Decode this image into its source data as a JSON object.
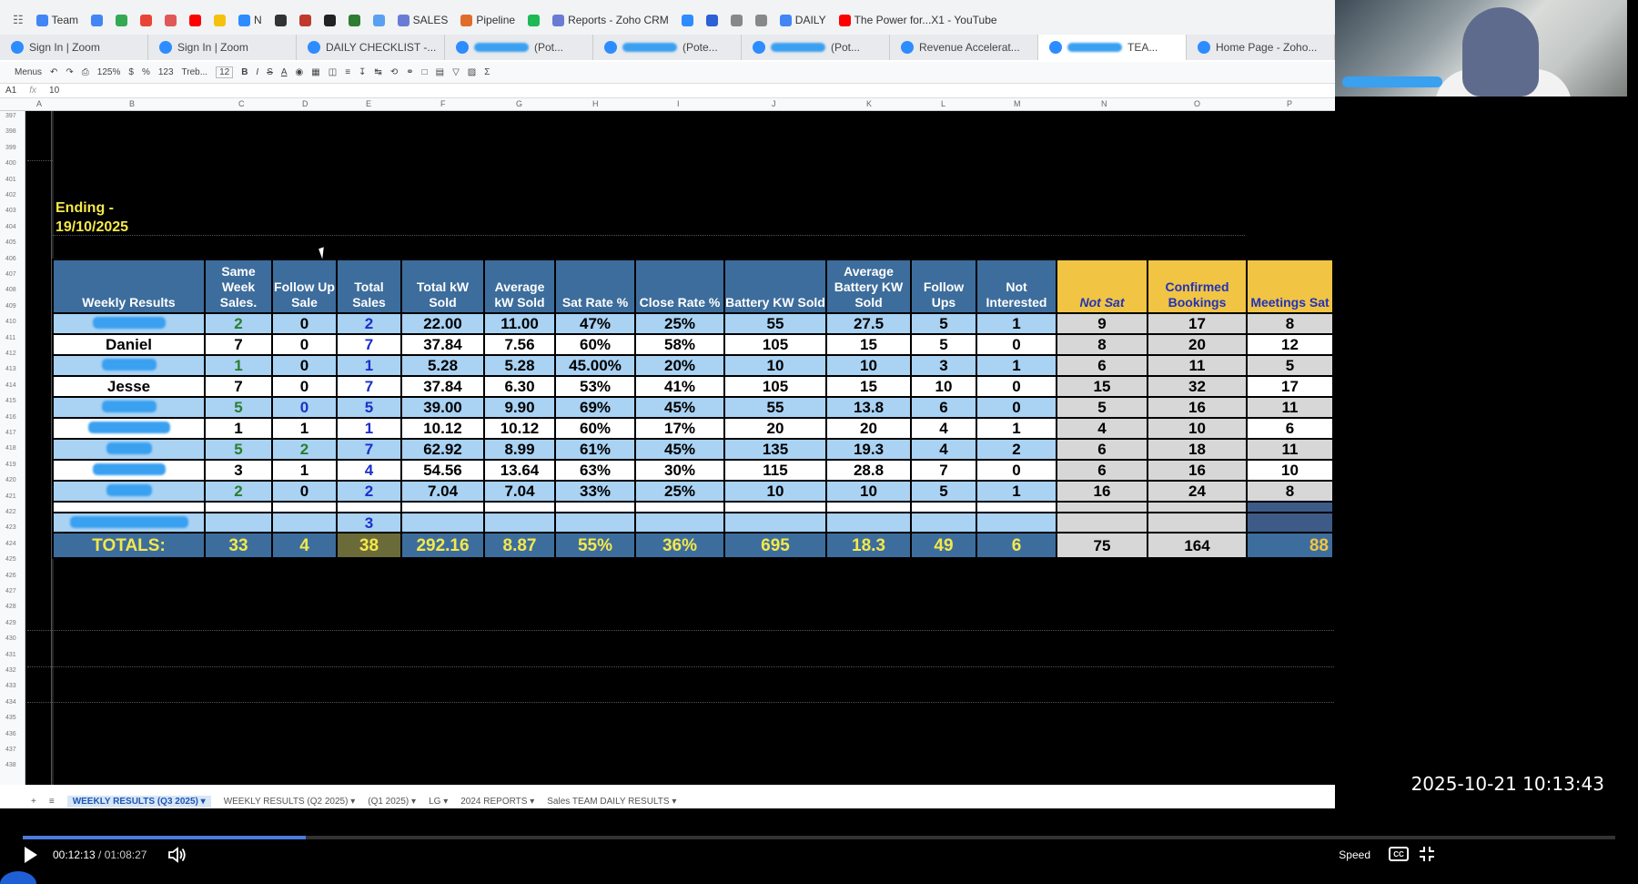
{
  "bookmarks": [
    {
      "label": "Team",
      "color": "#4285f4"
    },
    {
      "label": "",
      "color": "#4285f4"
    },
    {
      "label": "",
      "color": "#34a853"
    },
    {
      "label": "",
      "color": "#ea4335"
    },
    {
      "label": "",
      "color": "#e05757"
    },
    {
      "label": "",
      "color": "#ff0000"
    },
    {
      "label": "",
      "color": "#f4c20d"
    },
    {
      "label": "N",
      "color": "#2d8cff"
    },
    {
      "label": "",
      "color": "#333333"
    },
    {
      "label": "",
      "color": "#c0392b"
    },
    {
      "label": "",
      "color": "#222222"
    },
    {
      "label": "",
      "color": "#2e7d32"
    },
    {
      "label": "",
      "color": "#5aa0f0"
    },
    {
      "label": "SALES",
      "color": "#6a7bd6"
    },
    {
      "label": "Pipeline",
      "color": "#e06b2b"
    },
    {
      "label": "",
      "color": "#1db954"
    },
    {
      "label": "Reports - Zoho CRM",
      "color": "#6a7bd6"
    },
    {
      "label": "",
      "color": "#2d8cff"
    },
    {
      "label": "",
      "color": "#2d5fd6"
    },
    {
      "label": "",
      "color": "#888888"
    },
    {
      "label": "",
      "color": "#888888"
    },
    {
      "label": "DAILY",
      "color": "#4285f4"
    },
    {
      "label": "The Power for...X1 - YouTube",
      "color": "#ff0000"
    }
  ],
  "tabs": [
    {
      "label": "Sign In | Zoom"
    },
    {
      "label": "Sign In | Zoom"
    },
    {
      "label": "DAILY CHECKLIST -..."
    },
    {
      "label": "(Pot..."
    },
    {
      "label": "(Pote..."
    },
    {
      "label": "(Pot..."
    },
    {
      "label": "Revenue Accelerat..."
    },
    {
      "label": "TEA..."
    },
    {
      "label": "Home Page - Zoho..."
    }
  ],
  "toolbar": {
    "menus": "Menus",
    "zoom": "125%",
    "currency": "$",
    "percent": "%",
    "number_format": "123",
    "font": "Treb...",
    "font_size": "12"
  },
  "formula_bar": {
    "cell": "A1",
    "value": "10"
  },
  "columns": [
    "A",
    "B",
    "C",
    "D",
    "E",
    "F",
    "G",
    "H",
    "I",
    "J",
    "K",
    "L",
    "M",
    "N",
    "O",
    "P"
  ],
  "row_numbers": [
    "397",
    "398",
    "399",
    "400",
    "401",
    "402",
    "403",
    "404",
    "405",
    "406",
    "407",
    "408",
    "409",
    "410",
    "411",
    "412",
    "413",
    "414",
    "415",
    "416",
    "417",
    "418",
    "419",
    "420",
    "421",
    "422",
    "423",
    "424",
    "425",
    "426",
    "427",
    "428",
    "429",
    "430",
    "431",
    "432",
    "433",
    "434",
    "435",
    "436",
    "437",
    "438"
  ],
  "sheet": {
    "ending_label": "Ending -",
    "ending_date": "19/10/2025"
  },
  "table": {
    "headers": [
      "Weekly Results",
      "Same Week Sales.",
      "Follow Up Sale",
      "Total Sales",
      "Total kW Sold",
      "Average kW Sold",
      "Sat Rate  %",
      "Close Rate %",
      "Battery KW Sold",
      "Average Battery KW Sold",
      "Follow Ups",
      "Not Interested",
      "Not Sat",
      "Confirmed Bookings",
      "Meetings Sat"
    ],
    "rows": [
      {
        "name": "",
        "values": [
          "2",
          "0",
          "2",
          "22.00",
          "11.00",
          "47%",
          "25%",
          "55",
          "27.5",
          "5",
          "1",
          "9",
          "17",
          "8"
        ]
      },
      {
        "name": "Daniel",
        "values": [
          "7",
          "0",
          "7",
          "37.84",
          "7.56",
          "60%",
          "58%",
          "105",
          "15",
          "5",
          "0",
          "8",
          "20",
          "12"
        ]
      },
      {
        "name": "",
        "values": [
          "1",
          "0",
          "1",
          "5.28",
          "5.28",
          "45.00%",
          "20%",
          "10",
          "10",
          "3",
          "1",
          "6",
          "11",
          "5"
        ]
      },
      {
        "name": "Jesse",
        "values": [
          "7",
          "0",
          "7",
          "37.84",
          "6.30",
          "53%",
          "41%",
          "105",
          "15",
          "10",
          "0",
          "15",
          "32",
          "17"
        ]
      },
      {
        "name": "",
        "values": [
          "5",
          "0",
          "5",
          "39.00",
          "9.90",
          "69%",
          "45%",
          "55",
          "13.8",
          "6",
          "0",
          "5",
          "16",
          "11"
        ]
      },
      {
        "name": "",
        "values": [
          "1",
          "1",
          "1",
          "10.12",
          "10.12",
          "60%",
          "17%",
          "20",
          "20",
          "4",
          "1",
          "4",
          "10",
          "6"
        ]
      },
      {
        "name": "",
        "values": [
          "5",
          "2",
          "7",
          "62.92",
          "8.99",
          "61%",
          "45%",
          "135",
          "19.3",
          "4",
          "2",
          "6",
          "18",
          "11"
        ]
      },
      {
        "name": "",
        "values": [
          "3",
          "1",
          "4",
          "54.56",
          "13.64",
          "63%",
          "30%",
          "115",
          "28.8",
          "7",
          "0",
          "6",
          "16",
          "10"
        ]
      },
      {
        "name": "",
        "values": [
          "2",
          "0",
          "2",
          "7.04",
          "7.04",
          "33%",
          "25%",
          "10",
          "10",
          "5",
          "1",
          "16",
          "24",
          "8"
        ]
      }
    ],
    "extra_row": {
      "total_sales": "3"
    },
    "totals": {
      "label": "TOTALS:",
      "values": [
        "33",
        "4",
        "38",
        "292.16",
        "8.87",
        "55%",
        "36%",
        "695",
        "18.3",
        "49",
        "6",
        "75",
        "164",
        "88"
      ]
    }
  },
  "sheet_tabs": [
    {
      "label": "WEEKLY RESULTS (Q3 2025)",
      "active": true
    },
    {
      "label": "WEEKLY RESULTS (Q2 2025)",
      "active": false
    },
    {
      "label": "(Q1 2025)",
      "active": false
    },
    {
      "label": "LG",
      "active": false
    },
    {
      "label": "2024 REPORTS",
      "active": false
    },
    {
      "label": "Sales TEAM DAILY RESULTS",
      "active": false
    }
  ],
  "overlay": {
    "timestamp": "2025-10-21  10:13:43"
  },
  "player": {
    "current_time": "00:12:13",
    "separator": " / ",
    "duration": "01:08:27",
    "speed_label": "Speed",
    "cc_label": "CC",
    "progress_fraction": 0.178
  },
  "colors": {
    "header_blue": "#3d6d9c",
    "band_blue": "#a9d2f3",
    "header_yellow": "#f1c443",
    "totals_text": "#f5e84a",
    "green_value": "#2c7e2d",
    "blue_value": "#1b2fc9"
  }
}
